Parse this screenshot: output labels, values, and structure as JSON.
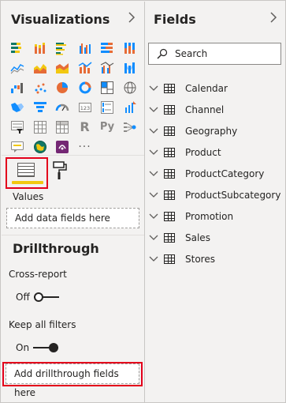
{
  "visualizations": {
    "title": "Visualizations",
    "collapse_icon": "chevron-right-icon",
    "icons": [
      "stacked-bar-chart-icon",
      "stacked-column-chart-icon",
      "clustered-bar-chart-icon",
      "clustered-column-chart-icon",
      "100-percent-bar-chart-icon",
      "100-percent-column-chart-icon",
      "line-chart-icon",
      "area-chart-icon",
      "stacked-area-chart-icon",
      "line-and-column-chart-icon",
      "line-and-clustered-column-chart-icon",
      "ribbon-chart-icon",
      "waterfall-chart-icon",
      "scatter-chart-icon",
      "pie-chart-icon",
      "donut-chart-icon",
      "treemap-icon",
      "map-icon",
      "filled-map-icon",
      "funnel-icon",
      "gauge-icon",
      "card-icon",
      "multi-row-card-icon",
      "kpi-icon",
      "slicer-icon",
      "table-icon",
      "matrix-icon",
      "r-visual-icon",
      "python-visual-icon",
      "key-influencers-icon",
      "q-and-a-icon",
      "arcgis-map-icon",
      "power-apps-icon",
      "more-visuals-icon"
    ],
    "r_glyph": "R",
    "py_glyph": "Py",
    "more_glyph": "···",
    "tabs": {
      "fields_icon": "fields-well-icon",
      "format_icon": "paint-roller-icon"
    },
    "values_label": "Values",
    "values_placeholder": "Add data fields here",
    "drillthrough": {
      "title": "Drillthrough",
      "cross_report_label": "Cross-report",
      "cross_report_state": "Off",
      "keep_filters_label": "Keep all filters",
      "keep_filters_state": "On",
      "placeholder": "Add drillthrough fields here"
    }
  },
  "fields": {
    "title": "Fields",
    "collapse_icon": "chevron-right-icon",
    "search_placeholder": "Search",
    "tables": [
      "Calendar",
      "Channel",
      "Geography",
      "Product",
      "ProductCategory",
      "ProductSubcategory",
      "Promotion",
      "Sales",
      "Stores"
    ]
  },
  "colors": {
    "accent_yellow": "#f2c811",
    "highlight_red": "#e3001b",
    "pane_bg": "#f3f2f1"
  }
}
